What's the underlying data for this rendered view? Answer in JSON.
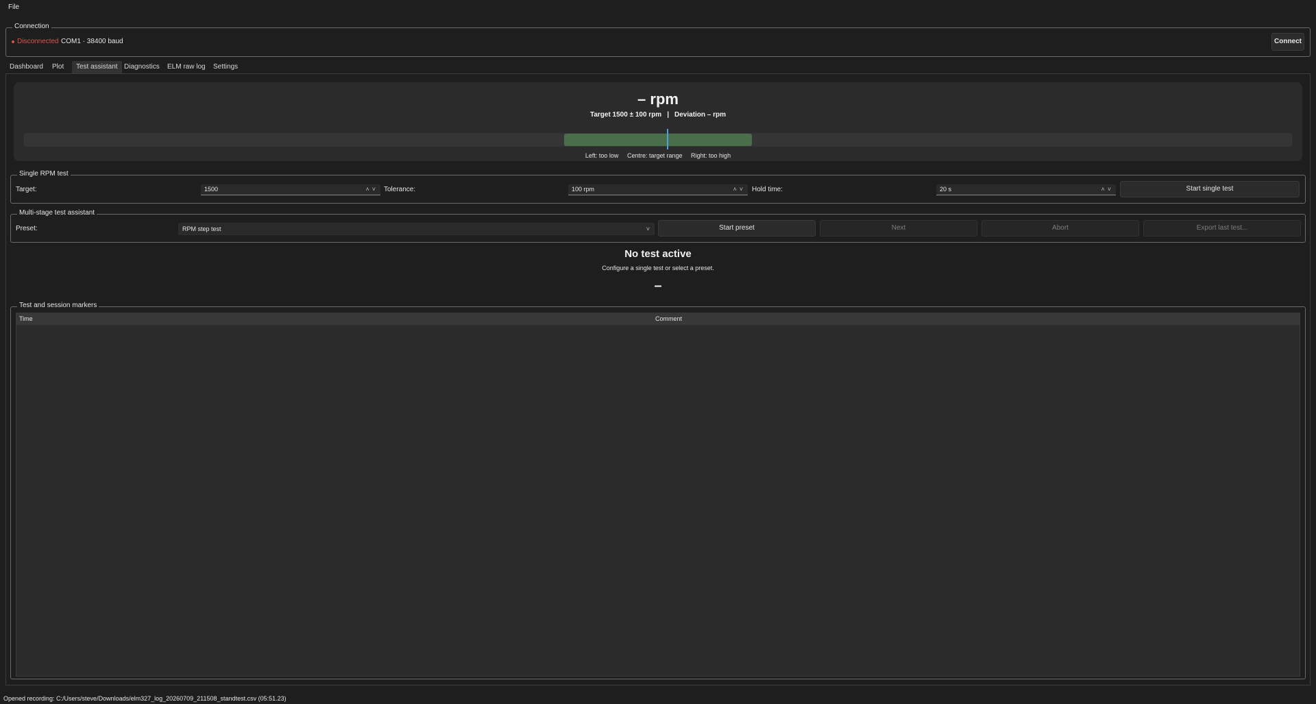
{
  "menu": {
    "file": "File"
  },
  "connection": {
    "group_title": "Connection",
    "status": "Disconnected",
    "status_color": "#d9534f",
    "port": "COM1 · 38400 baud",
    "connect_label": "Connect"
  },
  "tabs": [
    {
      "label": "Dashboard"
    },
    {
      "label": "Plot"
    },
    {
      "label": "Test assistant",
      "active": true
    },
    {
      "label": "Diagnostics"
    },
    {
      "label": "ELM raw log"
    },
    {
      "label": "Settings"
    }
  ],
  "gauge": {
    "value_text": "– rpm",
    "target_text": "Target 1500 ± 100 rpm",
    "separator": "|",
    "deviation_text": "Deviation – rpm",
    "legend_left": "Left: too low",
    "legend_centre": "Centre: target range",
    "legend_right": "Right: too high",
    "zone_color": "#4a6e4a",
    "needle_color": "#4ea3d9"
  },
  "single_test": {
    "group_title": "Single RPM test",
    "target_label": "Target:",
    "target_value": "1500",
    "tolerance_label": "Tolerance:",
    "tolerance_value": "100 rpm",
    "hold_label": "Hold time:",
    "hold_value": "20 s",
    "start_label": "Start single test"
  },
  "multi_stage": {
    "group_title": "Multi-stage test assistant",
    "preset_label": "Preset:",
    "preset_value": "RPM step test",
    "start_preset_label": "Start preset",
    "next_label": "Next",
    "abort_label": "Abort",
    "export_label": "Export last test..."
  },
  "test_status": {
    "title": "No test active",
    "subtitle": "Configure a single test or select a preset.",
    "indicator": "–"
  },
  "markers": {
    "group_title": "Test and session markers",
    "columns": [
      "Time",
      "Comment"
    ],
    "rows": []
  },
  "statusbar": {
    "message": "Opened recording: C:/Users/steve/Downloads/elm327_log_20260709_211508_standtest.csv (05:51.23)"
  }
}
